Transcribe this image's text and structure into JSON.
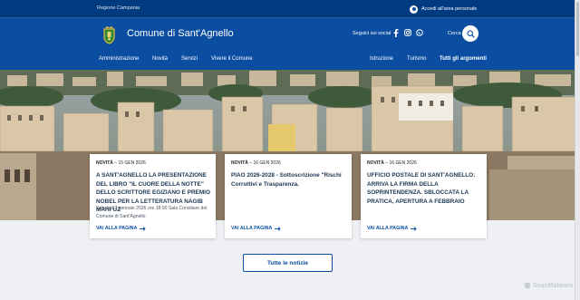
{
  "slim_header": {
    "region": "Regione Campania",
    "login": "Accedi all'area personale"
  },
  "header": {
    "title": "Comune di Sant'Agnello",
    "social_label": "Seguici sui social",
    "social_icons": [
      "facebook-icon",
      "instagram-icon",
      "whatsapp-icon"
    ],
    "search_label": "Cerca"
  },
  "nav": {
    "left": [
      "Amministrazione",
      "Novità",
      "Servizi",
      "Vivere il Comune"
    ],
    "right": [
      "Istruzione",
      "Turismo",
      "Tutti gli argomenti"
    ]
  },
  "cards": [
    {
      "category": "NOVITÀ",
      "date": "15 GEN 2026",
      "title": "A SANT'AGNELLO LA PRESENTAZIONE DEL LIBRO \"IL CUORE DELLA NOTTE\" DELLO SCRITTORE EGIZIANO E PREMIO NOBEL PER LA LETTERATURA NAGIB MAHFUZ",
      "description": "Sabato 17 gennaio 2026 ore 18:00 Sala Consiliare del Comune di Sant'Agnello",
      "link": "VAI ALLA PAGINA"
    },
    {
      "category": "NOVITÀ",
      "date": "16 GEN 2026",
      "title": "PIAO 2026-2028 - Sottoscrizione \"Rischi Corruttivi e Trasparenza.",
      "description": "",
      "link": "VAI ALLA PAGINA"
    },
    {
      "category": "NOVITÀ",
      "date": "16 GEN 2026",
      "title": "UFFICIO POSTALE DI SANT'AGNELLO: ARRIVA LA FIRMA DELLA SOPRINTENDENZA. SBLOCCATA LA PRATICA, APERTURA A FEBBRAIO",
      "description": "",
      "link": "VAI ALLA PAGINA"
    }
  ],
  "all_news": "Tutte le notizie",
  "watermark": "ScanMalware",
  "colors": {
    "primary": "#0b4ea1",
    "dark": "#003b80",
    "title": "#1a3552"
  }
}
